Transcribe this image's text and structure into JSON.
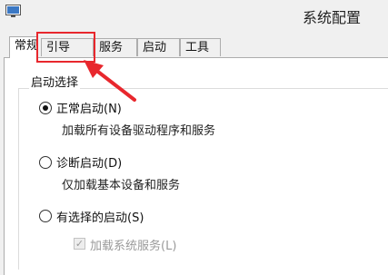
{
  "window": {
    "title": "系统配置",
    "icon": "system-config-icon"
  },
  "tabs": [
    {
      "label": "常规",
      "active": true
    },
    {
      "label": "引导",
      "active": false
    },
    {
      "label": "服务",
      "active": false
    },
    {
      "label": "启动",
      "active": false
    },
    {
      "label": "工具",
      "active": false
    }
  ],
  "startup": {
    "group_title": "启动选择",
    "options": [
      {
        "label": "正常启动(N)",
        "description": "加载所有设备驱动程序和服务",
        "checked": true
      },
      {
        "label": "诊断启动(D)",
        "description": "仅加载基本设备和服务",
        "checked": false
      },
      {
        "label": "有选择的启动(S)",
        "checked": false
      }
    ],
    "sub_option": {
      "label": "加载系统服务(L)",
      "checked": true,
      "disabled": true
    }
  },
  "annotation": {
    "color": "#e8272d",
    "target": "引导"
  }
}
